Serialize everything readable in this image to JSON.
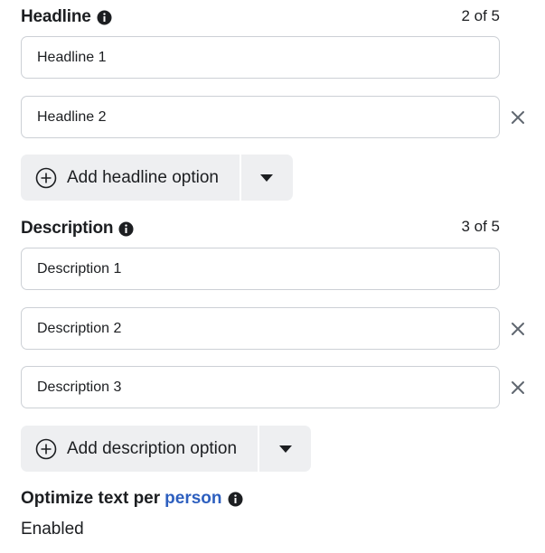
{
  "headline": {
    "title": "Headline",
    "counter": "2 of 5",
    "fields": [
      "Headline 1",
      "Headline 2"
    ],
    "add_label": "Add headline option"
  },
  "description": {
    "title": "Description",
    "counter": "3 of 5",
    "fields": [
      "Description 1",
      "Description 2",
      "Description 3"
    ],
    "add_label": "Add description option"
  },
  "optimize": {
    "label": "Optimize text per",
    "link": "person",
    "status": "Enabled"
  },
  "icons": {
    "info": "info-icon",
    "remove": "close-icon",
    "add": "plus-circle-icon",
    "dropdown": "caret-down-icon"
  },
  "colors": {
    "link": "#2d5fbf",
    "button_bg": "#eeeff1",
    "border": "#ccd0d5"
  }
}
